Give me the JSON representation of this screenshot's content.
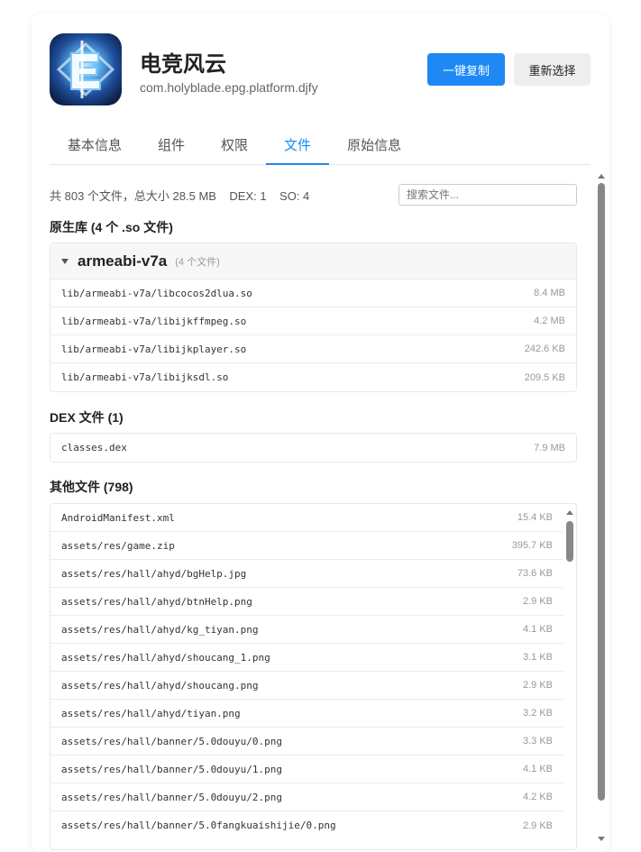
{
  "app": {
    "name": "电竞风云",
    "package": "com.holyblade.epg.platform.djfy",
    "icon": "app-logo-icon"
  },
  "actions": {
    "copy_label": "一键复制",
    "reselect_label": "重新选择"
  },
  "tabs": [
    {
      "label": "基本信息",
      "active": false
    },
    {
      "label": "组件",
      "active": false
    },
    {
      "label": "权限",
      "active": false
    },
    {
      "label": "文件",
      "active": true
    },
    {
      "label": "原始信息",
      "active": false
    }
  ],
  "summary": "共 803 个文件，总大小 28.5 MB    DEX: 1    SO: 4",
  "search": {
    "placeholder": "搜索文件..."
  },
  "native": {
    "title": "原生库 (4 个 .so 文件)",
    "group": {
      "name": "armeabi-v7a",
      "count": "(4 个文件)",
      "files": [
        {
          "name": "lib/armeabi-v7a/libcocos2dlua.so",
          "size": "8.4 MB"
        },
        {
          "name": "lib/armeabi-v7a/libijkffmpeg.so",
          "size": "4.2 MB"
        },
        {
          "name": "lib/armeabi-v7a/libijkplayer.so",
          "size": "242.6 KB"
        },
        {
          "name": "lib/armeabi-v7a/libijksdl.so",
          "size": "209.5 KB"
        }
      ]
    }
  },
  "dex": {
    "title": "DEX 文件 (1)",
    "files": [
      {
        "name": "classes.dex",
        "size": "7.9 MB"
      }
    ]
  },
  "other": {
    "title": "其他文件 (798)",
    "files": [
      {
        "name": "AndroidManifest.xml",
        "size": "15.4 KB"
      },
      {
        "name": "assets/res/game.zip",
        "size": "395.7 KB"
      },
      {
        "name": "assets/res/hall/ahyd/bgHelp.jpg",
        "size": "73.6 KB"
      },
      {
        "name": "assets/res/hall/ahyd/btnHelp.png",
        "size": "2.9 KB"
      },
      {
        "name": "assets/res/hall/ahyd/kg_tiyan.png",
        "size": "4.1 KB"
      },
      {
        "name": "assets/res/hall/ahyd/shoucang_1.png",
        "size": "3.1 KB"
      },
      {
        "name": "assets/res/hall/ahyd/shoucang.png",
        "size": "2.9 KB"
      },
      {
        "name": "assets/res/hall/ahyd/tiyan.png",
        "size": "3.2 KB"
      },
      {
        "name": "assets/res/hall/banner/5.0douyu/0.png",
        "size": "3.3 KB"
      },
      {
        "name": "assets/res/hall/banner/5.0douyu/1.png",
        "size": "4.1 KB"
      },
      {
        "name": "assets/res/hall/banner/5.0douyu/2.png",
        "size": "4.2 KB"
      },
      {
        "name": "assets/res/hall/banner/5.0fangkuaishijie/0.png",
        "size": "2.9 KB"
      }
    ]
  },
  "colors": {
    "accent": "#1e88f5"
  }
}
